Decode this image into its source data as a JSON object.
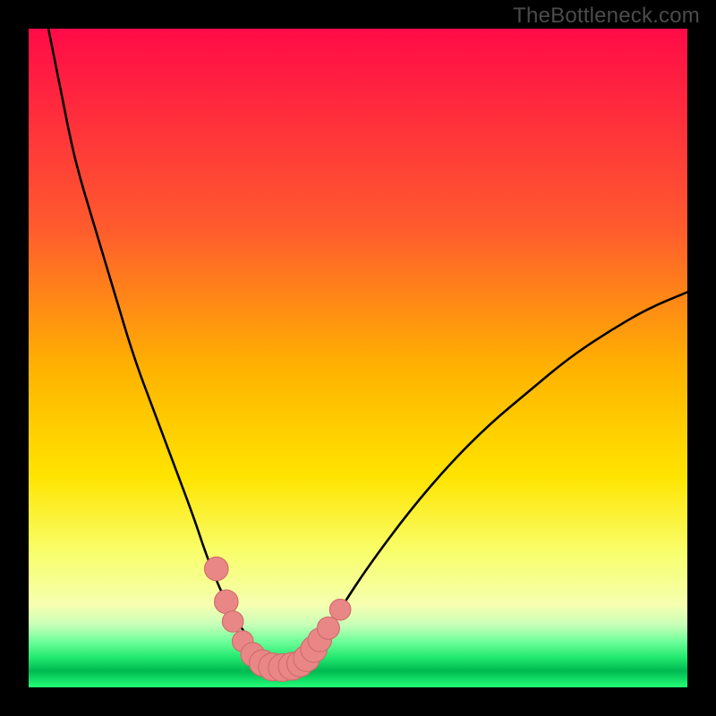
{
  "watermark": "TheBottleneck.com",
  "colors": {
    "bg_black": "#000000",
    "grad_top": "#ff0b47",
    "grad_mid": "#ffe400",
    "grad_low": "#f6ff8f",
    "grad_green_dark": "#00a540",
    "grad_green_light": "#23ff77",
    "curve": "#000000",
    "marker_fill": "#e98787",
    "marker_stroke": "#d06a6a"
  },
  "chart_data": {
    "type": "line",
    "title": "",
    "xlabel": "",
    "ylabel": "",
    "xlim": [
      0,
      100
    ],
    "ylim": [
      0,
      100
    ],
    "note": "Axes are unitless (no tick labels shown). Values are pixel-read estimates normalized to 0–100 with y=0 at bottom, y=100 at top.",
    "series": [
      {
        "name": "bottleneck-curve",
        "x": [
          3,
          5,
          7,
          10,
          13,
          16,
          19,
          22,
          25,
          27,
          29,
          31,
          33,
          35,
          36.5,
          38,
          40,
          42,
          45,
          48,
          52,
          58,
          64,
          70,
          76,
          82,
          88,
          94,
          100
        ],
        "y": [
          100,
          90,
          80,
          70,
          60,
          50,
          42,
          34,
          26,
          20,
          15,
          11,
          8,
          5,
          3.5,
          3,
          3.2,
          4,
          8,
          13,
          19,
          27,
          34,
          40,
          45,
          50,
          54,
          57.5,
          60
        ]
      }
    ],
    "markers": [
      {
        "x": 28.5,
        "y": 18,
        "r": 1.8
      },
      {
        "x": 30,
        "y": 13,
        "r": 1.8
      },
      {
        "x": 31,
        "y": 10,
        "r": 1.6
      },
      {
        "x": 32.5,
        "y": 7,
        "r": 1.6
      },
      {
        "x": 34,
        "y": 5,
        "r": 1.8
      },
      {
        "x": 35.5,
        "y": 3.7,
        "r": 2.0
      },
      {
        "x": 37,
        "y": 3.1,
        "r": 2.1
      },
      {
        "x": 38.5,
        "y": 3.0,
        "r": 2.1
      },
      {
        "x": 40,
        "y": 3.2,
        "r": 2.1
      },
      {
        "x": 41.2,
        "y": 3.6,
        "r": 2.0
      },
      {
        "x": 42.2,
        "y": 4.4,
        "r": 2.0
      },
      {
        "x": 43.3,
        "y": 5.8,
        "r": 2.0
      },
      {
        "x": 44.2,
        "y": 7.2,
        "r": 1.8
      },
      {
        "x": 45.5,
        "y": 9.0,
        "r": 1.7
      },
      {
        "x": 47.3,
        "y": 11.8,
        "r": 1.6
      }
    ],
    "gradient_stops": [
      {
        "offset": 0.0,
        "color": "#ff0b47"
      },
      {
        "offset": 0.3,
        "color": "#ff5a2e"
      },
      {
        "offset": 0.52,
        "color": "#ffb400"
      },
      {
        "offset": 0.68,
        "color": "#ffe400"
      },
      {
        "offset": 0.8,
        "color": "#f8ff70"
      },
      {
        "offset": 0.875,
        "color": "#f6ffb0"
      },
      {
        "offset": 0.905,
        "color": "#c8ffb8"
      },
      {
        "offset": 0.93,
        "color": "#6fff9a"
      },
      {
        "offset": 0.955,
        "color": "#22e96e"
      },
      {
        "offset": 0.975,
        "color": "#00b851"
      },
      {
        "offset": 1.0,
        "color": "#23ff77"
      }
    ]
  }
}
